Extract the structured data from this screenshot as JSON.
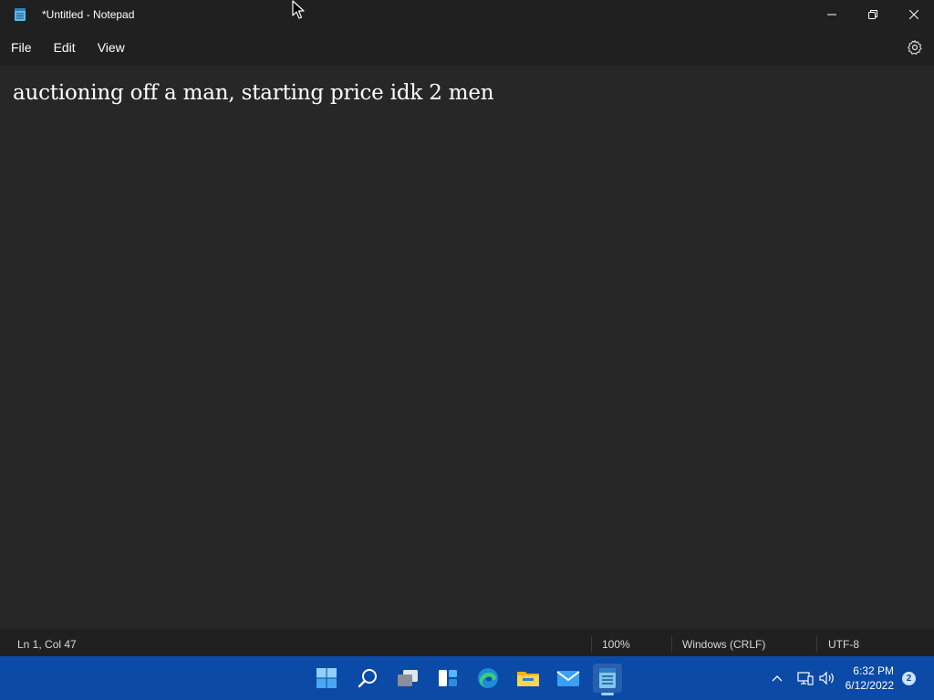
{
  "window": {
    "title": "*Untitled - Notepad",
    "app_icon": "notepad-icon",
    "controls": [
      "minimize-icon",
      "restore-icon",
      "close-icon"
    ]
  },
  "menu": {
    "items": [
      {
        "label": "File"
      },
      {
        "label": "Edit"
      },
      {
        "label": "View"
      }
    ],
    "settings_icon": "gear-icon"
  },
  "editor": {
    "content": "auctioning off a man, starting price idk 2 men"
  },
  "status": {
    "position": "Ln 1, Col 47",
    "zoom": "100%",
    "line_endings": "Windows (CRLF)",
    "encoding": "UTF-8"
  },
  "taskbar": {
    "icons": [
      "start-icon",
      "search-icon",
      "task-view-icon",
      "widgets-icon",
      "edge-icon",
      "file-explorer-icon",
      "mail-icon",
      "notepad-icon"
    ],
    "active": "notepad-icon",
    "tray_icons": [
      "chevron-up-icon",
      "network-icon",
      "volume-icon"
    ],
    "time": "6:32 PM",
    "date": "6/12/2022",
    "notification_count": "2"
  },
  "colors": {
    "editor_bg": "#272727",
    "chrome_bg": "#202020",
    "taskbar_bg": "#0b4aa6",
    "text": "#ffffff"
  }
}
